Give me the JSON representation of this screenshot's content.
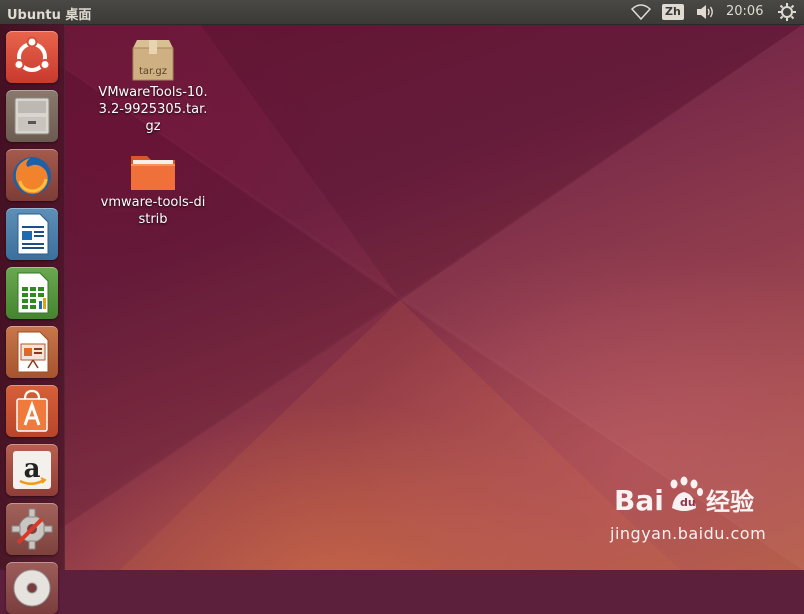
{
  "top_panel": {
    "title": "Ubuntu 桌面",
    "input_method": "Zh",
    "clock": "20:06"
  },
  "launcher": {
    "items": [
      {
        "name": "dash-home",
        "icon": "ubuntu-logo-icon"
      },
      {
        "name": "files",
        "icon": "file-cabinet-icon"
      },
      {
        "name": "firefox",
        "icon": "firefox-icon"
      },
      {
        "name": "libreoffice-writer",
        "icon": "writer-document-icon"
      },
      {
        "name": "libreoffice-calc",
        "icon": "calc-spreadsheet-icon"
      },
      {
        "name": "libreoffice-impress",
        "icon": "impress-presentation-icon"
      },
      {
        "name": "ubuntu-software-center",
        "icon": "shopping-bag-icon"
      },
      {
        "name": "amazon",
        "icon": "amazon-icon"
      },
      {
        "name": "system-settings",
        "icon": "settings-wrench-icon"
      },
      {
        "name": "dvd",
        "icon": "disc-icon"
      }
    ]
  },
  "desktop": {
    "icons": [
      {
        "label": "VMwareTools-10.3.2-9925305.tar.gz",
        "badge": "tar.gz",
        "icon": "archive-box-icon"
      },
      {
        "label": "vmware-tools-distrib",
        "icon": "folder-icon"
      }
    ]
  },
  "watermark": {
    "brand": "Bai  经验",
    "url": "jingyan.baidu.com"
  },
  "colors": {
    "panel": "#3b3a37",
    "launcher_tile_red": "#d94c38",
    "folder_orange": "#f0703a"
  }
}
